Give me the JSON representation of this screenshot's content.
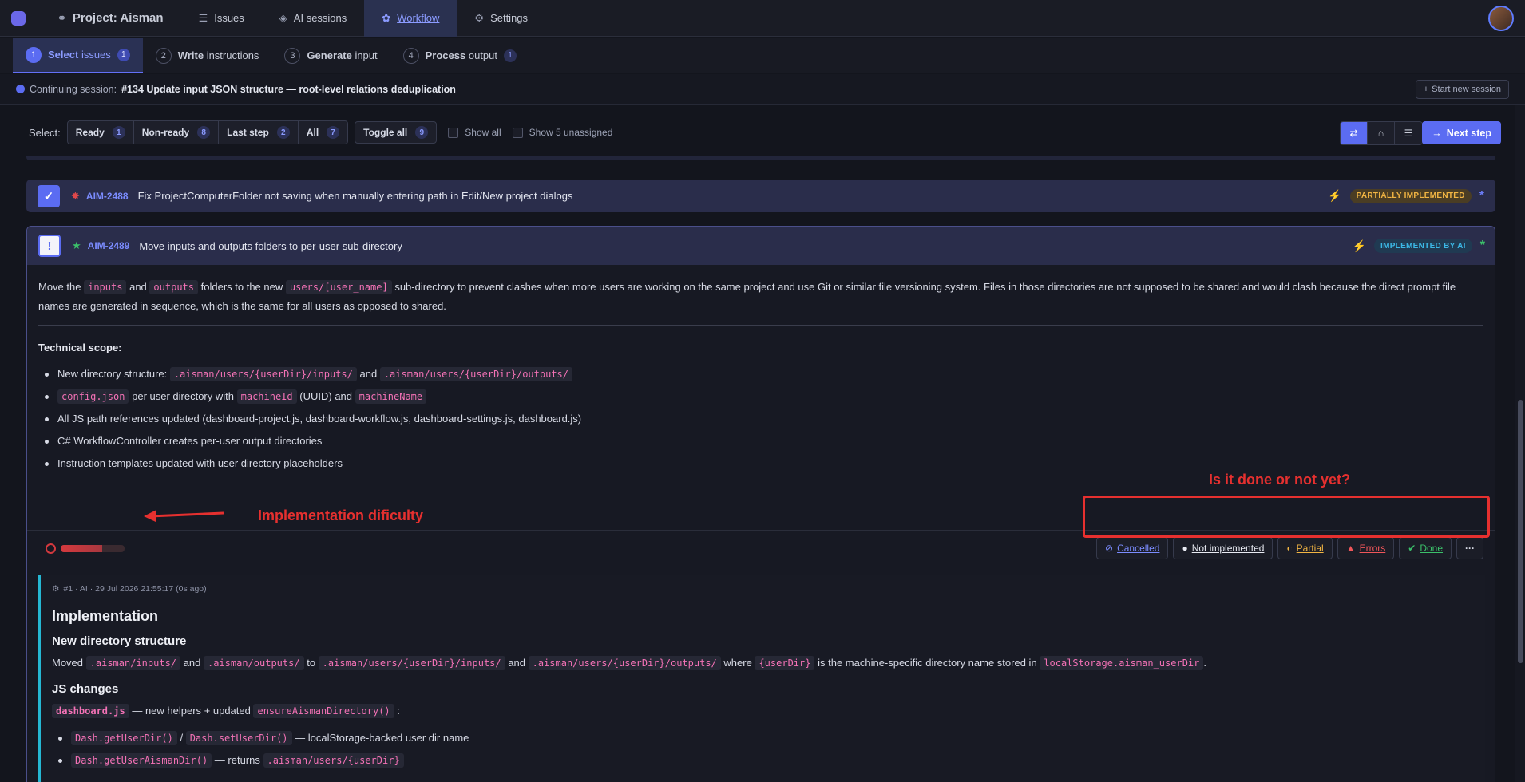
{
  "nav": {
    "project": "Project: Aisman",
    "tabs": [
      "Issues",
      "AI sessions",
      "Workflow",
      "Settings"
    ]
  },
  "steps": [
    {
      "num": "1",
      "bold": "Select",
      "rest": "issues",
      "count": "1"
    },
    {
      "num": "2",
      "bold": "Write",
      "rest": "instructions",
      "count": ""
    },
    {
      "num": "3",
      "bold": "Generate",
      "rest": "input",
      "count": ""
    },
    {
      "num": "4",
      "bold": "Process",
      "rest": "output",
      "count": "1"
    }
  ],
  "session": {
    "prefix": "Continuing session:",
    "title": "#134 Update input JSON structure — root-level relations deduplication",
    "new_button": "Start new session"
  },
  "selectbar": {
    "label": "Select:",
    "filters": [
      {
        "label": "Ready",
        "count": "1"
      },
      {
        "label": "Non-ready",
        "count": "8"
      },
      {
        "label": "Last step",
        "count": "2"
      },
      {
        "label": "All",
        "count": "7"
      }
    ],
    "toggle_all": {
      "label": "Toggle all",
      "count": "9"
    },
    "show_all": "Show all",
    "show_unassigned": "Show 5 unassigned",
    "next_step": "Next step"
  },
  "issues": [
    {
      "key": "AIM-2488",
      "title": "Fix ProjectComputerFolder not saving when manually entering path in Edit/New project dialogs",
      "status": "PARTIALLY IMPLEMENTED"
    },
    {
      "key": "AIM-2489",
      "title": "Move inputs and outputs folders to per-user sub-directory",
      "status": "IMPLEMENTED BY AI"
    }
  ],
  "description": {
    "p1_a": "Move the",
    "p1_code1": "inputs",
    "p1_b": "and",
    "p1_code2": "outputs",
    "p1_c": "folders to the new",
    "p1_code3": "users/[user_name]",
    "p1_d": "sub-directory to prevent clashes when more users are working on the same project and use Git or similar file versioning system. Files in those directories are not supposed to be shared and would clash because the direct prompt file names are generated in sequence, which is the same for all users as opposed to shared.",
    "scope_title": "Technical scope:",
    "s1_a": "New directory structure:",
    "s1_code1": ".aisman/users/{userDir}/inputs/",
    "s1_b": "and",
    "s1_code2": ".aisman/users/{userDir}/outputs/",
    "s2_code1": "config.json",
    "s2_a": "per user directory with",
    "s2_code2": "machineId",
    "s2_b": "(UUID) and",
    "s2_code3": "machineName",
    "s3": "All JS path references updated (dashboard-project.js, dashboard-workflow.js, dashboard-settings.js, dashboard.js)",
    "s4": "C# WorkflowController creates per-user output directories",
    "s5": "Instruction templates updated with user directory placeholders"
  },
  "difficulty": {
    "fraction": 0.65
  },
  "status_buttons": [
    "Cancelled",
    "Not implemented",
    "Partial",
    "Errors",
    "Done",
    "···"
  ],
  "implementation": {
    "meta": "#1 · AI · 29 Jul 2026 21:55:17 (0s ago)",
    "h1": "Implementation",
    "h2a": "New directory structure",
    "p1_a": "Moved",
    "p1_c1": ".aisman/inputs/",
    "p1_b": "and",
    "p1_c2": ".aisman/outputs/",
    "p1_c": "to",
    "p1_c3": ".aisman/users/{userDir}/inputs/",
    "p1_d": "and",
    "p1_c4": ".aisman/users/{userDir}/outputs/",
    "p1_e": "where",
    "p1_c5": "{userDir}",
    "p1_f": "is the machine-specific directory name stored in",
    "p1_c6": "localStorage.aisman_userDir",
    "p1_g": ".",
    "h2b": "JS changes",
    "js_file": "dashboard.js",
    "js_a": "— new helpers + updated",
    "js_fn": "ensureAismanDirectory()",
    "js_colon": ":",
    "b1_c1": "Dash.getUserDir()",
    "b1_sep": "/",
    "b1_c2": "Dash.setUserDir()",
    "b1_a": "— localStorage-backed user dir name",
    "b2_c1": "Dash.getUserAismanDir()",
    "b2_a": "— returns",
    "b2_c2": ".aisman/users/{userDir}"
  },
  "annotations": {
    "question": "Is it done or not yet?",
    "difficulty_label": "Implementation dificulty"
  },
  "colors": {
    "accent": "#5b6cf2",
    "annotation": "#e6302f",
    "partial": "#f2b543",
    "ai": "#3cb8e6"
  }
}
